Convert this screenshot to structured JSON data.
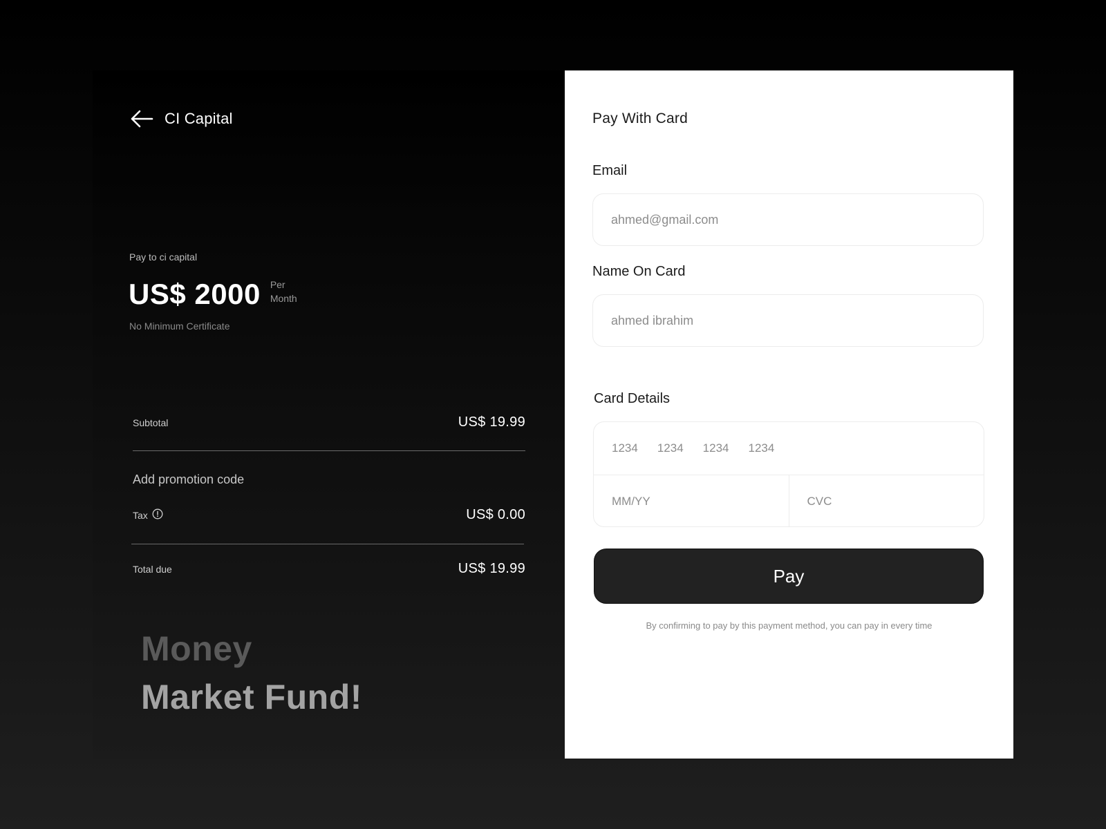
{
  "summary": {
    "brand": "CI Capital",
    "back_icon": "arrow-left-icon",
    "pay_to": "Pay to ci capital",
    "amount": "US$ 2000",
    "period_line1": "Per",
    "period_line2": "Month",
    "min_certificate": "No Minimum Certificate",
    "subtotal_label": "Subtotal",
    "subtotal_value": "US$ 19.99",
    "promo_label": "Add promotion code",
    "tax_label": "Tax",
    "tax_icon": "info-icon",
    "tax_value": "US$ 0.00",
    "total_label": "Total due",
    "total_value": "US$ 19.99",
    "slogan_line1": "Money",
    "slogan_line2": "Market Fund!"
  },
  "form": {
    "title": "Pay With Card",
    "email_label": "Email",
    "email_placeholder": "ahmed@gmail.com",
    "name_label": "Name On Card",
    "name_placeholder": "ahmed ibrahim",
    "card_label": "Card Details",
    "card_number_groups": [
      "1234",
      "1234",
      "1234",
      "1234"
    ],
    "expiry_placeholder": "MM/YY",
    "cvc_placeholder": "CVC",
    "pay_label": "Pay",
    "disclaimer": "By confirming to pay by this payment method, you can pay in every time"
  },
  "colors": {
    "pay_button": "#222222",
    "form_background": "#ffffff",
    "summary_background": "#000000"
  }
}
